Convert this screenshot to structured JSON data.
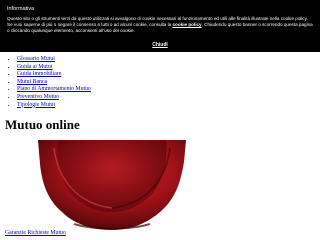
{
  "cookie_banner": {
    "title": "Informativa",
    "message_part1": "Questo sito o gli strumenti terzi da questo utilizzati si avvalgono di cookie necessari al funzionamento ed utili alle finalità illustrate nella cookie policy. Se vuoi saperne di più o negare il consenso a tutti o ad alcuni cookie, consulta la",
    "policy_link": "cookie policy",
    "message_part2": ". Chiudendo questo banner o scorrendo questa pagina o cliccando qualunque elemento, acconsenti all'uso dei cookie.",
    "close_label": "Chiudi"
  },
  "nav": {
    "items": [
      {
        "label": "Glossario Mutui"
      },
      {
        "label": "Guida ai Mutui"
      },
      {
        "label": "Guida Immobiliare"
      },
      {
        "label": "Mutui Banca"
      },
      {
        "label": "Piano di Ammortamento Mutuo"
      },
      {
        "label": "Preventivo Mutuo"
      },
      {
        "label": "Tipologie Mutui"
      }
    ]
  },
  "main": {
    "heading": "Mutuo online",
    "footer_link": "Garanzie Richieste Mutuo"
  },
  "colors": {
    "banner_bg": "#000000",
    "link": "#0000cc",
    "seal_red": "#9e1218"
  }
}
